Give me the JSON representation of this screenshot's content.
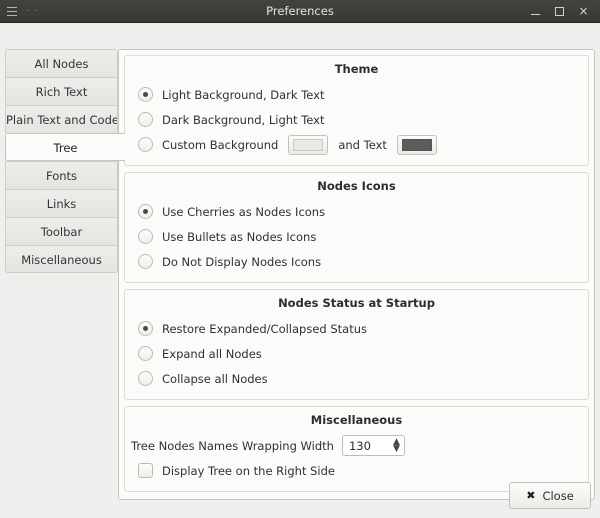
{
  "window": {
    "title": "Preferences",
    "menu_icon": "hamburger-icon",
    "left_dots": "·  ·",
    "minimize_label": "–",
    "maximize_label": "□",
    "close_label": "×"
  },
  "sidebar": {
    "items": [
      {
        "label": "All Nodes",
        "selected": false
      },
      {
        "label": "Rich Text",
        "selected": false
      },
      {
        "label": "Plain Text and Code",
        "selected": false
      },
      {
        "label": "Tree",
        "selected": true
      },
      {
        "label": "Fonts",
        "selected": false
      },
      {
        "label": "Links",
        "selected": false
      },
      {
        "label": "Toolbar",
        "selected": false
      },
      {
        "label": "Miscellaneous",
        "selected": false
      }
    ]
  },
  "sections": {
    "theme": {
      "title": "Theme",
      "options": [
        {
          "label": "Light Background, Dark Text",
          "selected": true
        },
        {
          "label": "Dark Background, Light Text",
          "selected": false
        },
        {
          "label": "Custom Background",
          "selected": false
        }
      ],
      "and_text_label": "and Text",
      "background_swatch_color": "#e9e9e6",
      "text_swatch_color": "#5a5a5a"
    },
    "nodes_icons": {
      "title": "Nodes Icons",
      "options": [
        {
          "label": "Use Cherries as Nodes Icons",
          "selected": true
        },
        {
          "label": "Use Bullets as Nodes Icons",
          "selected": false
        },
        {
          "label": "Do Not Display Nodes Icons",
          "selected": false
        }
      ]
    },
    "nodes_status": {
      "title": "Nodes Status at Startup",
      "options": [
        {
          "label": "Restore Expanded/Collapsed Status",
          "selected": true
        },
        {
          "label": "Expand all Nodes",
          "selected": false
        },
        {
          "label": "Collapse all Nodes",
          "selected": false
        }
      ]
    },
    "miscellaneous": {
      "title": "Miscellaneous",
      "wrapping_width_label": "Tree Nodes Names Wrapping Width",
      "wrapping_width_value": "130",
      "spin_up": "▲",
      "spin_down": "▼",
      "display_right_label": "Display Tree on the Right Side",
      "display_right_checked": false
    }
  },
  "footer": {
    "close_label": "Close",
    "close_icon": "✖"
  }
}
